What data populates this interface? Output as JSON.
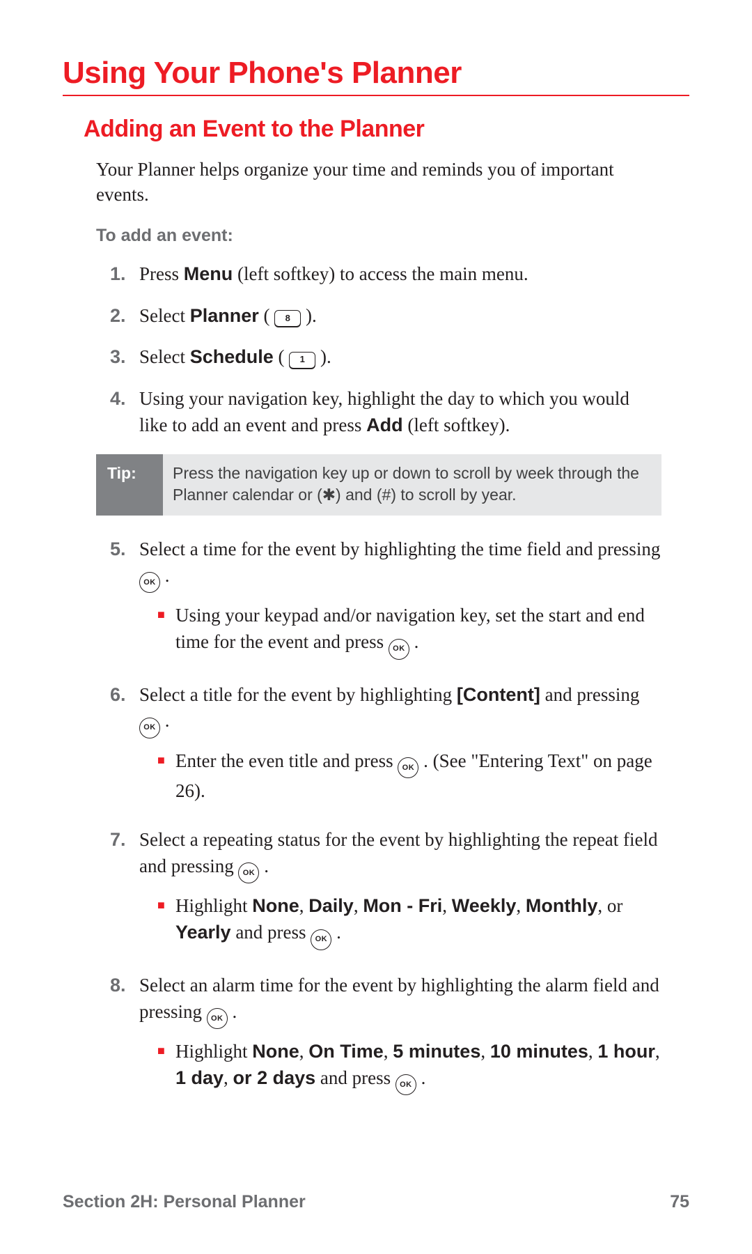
{
  "h1": "Using Your Phone's Planner",
  "h2": "Adding an Event to the Planner",
  "intro": "Your Planner helps organize your time and reminds you of important events.",
  "subhead": "To add an event:",
  "steps": {
    "n1": "1.",
    "s1a": "Press ",
    "s1b": "Menu",
    "s1c": " (left softkey) to access the main menu.",
    "n2": "2.",
    "s2a": "Select ",
    "s2b": "Planner",
    "s2c": " ( ",
    "key8": "8",
    "s2d": " ).",
    "n3": "3.",
    "s3a": "Select ",
    "s3b": "Schedule",
    "s3c": " ( ",
    "key1": "1",
    "s3d": " ).",
    "n4": "4.",
    "s4a": "Using your navigation key, highlight the day to which you would like to add an event and press ",
    "s4b": "Add",
    "s4c": " (left softkey).",
    "n5": "5.",
    "s5a": "Select a time for the event by highlighting the time field and pressing ",
    "ok": "OK",
    "s5b": " .",
    "s5_1a": "Using your keypad and/or navigation key, set the start and end time for the event and press ",
    "s5_1b": " .",
    "n6": "6.",
    "s6a": "Select a title for the event by highlighting ",
    "s6b": "[Content]",
    "s6c": " and pressing ",
    "s6d": " .",
    "s6_1a": "Enter the even title and press ",
    "s6_1b": " . (See \"Entering Text\" on page 26).",
    "n7": "7.",
    "s7a": "Select a repeating status for the event by highlighting the repeat field and pressing ",
    "s7b": " .",
    "s7_1a": "Highlight ",
    "s7_1b": "None",
    "s7_1c": ", ",
    "s7_1d": "Daily",
    "s7_1e": ", ",
    "s7_1f": "Mon - Fri",
    "s7_1g": ", ",
    "s7_1h": "Weekly",
    "s7_1i": ", ",
    "s7_1j": "Monthly",
    "s7_1k": ", or ",
    "s7_1l": "Yearly",
    "s7_1m": " and press ",
    "s7_1n": " .",
    "n8": "8.",
    "s8a": "Select an alarm time for the event by highlighting the alarm field and pressing ",
    "s8b": " .",
    "s8_1a": "Highlight ",
    "s8_1b": "None",
    "s8_1c": ", ",
    "s8_1d": "On Time",
    "s8_1e": ", ",
    "s8_1f": "5 minutes",
    "s8_1g": ", ",
    "s8_1h": "10 minutes",
    "s8_1i": ", ",
    "s8_1j": "1 hour",
    "s8_1k": ", ",
    "s8_1l": "1 day",
    "s8_1m": ", ",
    "s8_1n": "or ",
    "s8_1o": "2 days",
    "s8_1p": " and press ",
    "s8_1q": " ."
  },
  "tip": {
    "label": "Tip:",
    "body": "Press the navigation key up or down to scroll by week through the Planner calendar or (✱) and (#) to scroll by year."
  },
  "footer": {
    "section": "Section 2H: Personal Planner",
    "page": "75"
  },
  "sq": "■"
}
